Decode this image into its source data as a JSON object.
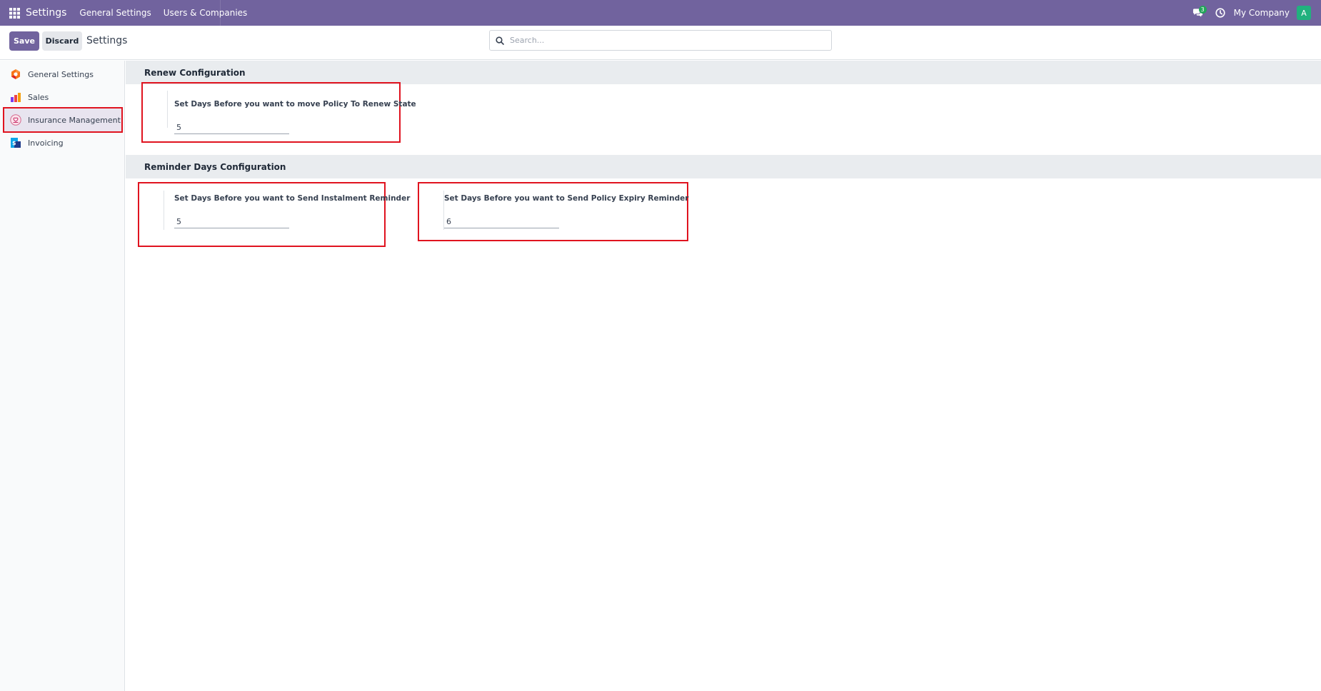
{
  "navbar": {
    "brand": "Settings",
    "menus": [
      "General Settings",
      "Users & Companies"
    ],
    "chat_badge": "3",
    "company": "My Company",
    "avatar_letter": "A",
    "color": "#71639e"
  },
  "control_panel": {
    "save_label": "Save",
    "discard_label": "Discard",
    "title": "Settings",
    "search_placeholder": "Search..."
  },
  "sidebar": {
    "items": [
      {
        "label": "General Settings",
        "icon": "general-settings-icon"
      },
      {
        "label": "Sales",
        "icon": "sales-icon"
      },
      {
        "label": "Insurance Management",
        "icon": "insurance-icon",
        "active": true
      },
      {
        "label": "Invoicing",
        "icon": "invoicing-icon"
      }
    ]
  },
  "sections": {
    "renew": {
      "title": "Renew Configuration",
      "settings": [
        {
          "label": "Set Days Before you want to move Policy To Renew State",
          "value": "5"
        }
      ]
    },
    "reminder": {
      "title": "Reminder Days Configuration",
      "settings": [
        {
          "label": "Set Days Before you want to Send Instalment Reminder",
          "value": "5"
        },
        {
          "label": "Set Days Before you want to Send Policy Expiry Reminder",
          "value": "6"
        }
      ]
    }
  },
  "colors": {
    "highlight": "#e0131f",
    "primary": "#71639e",
    "section_bg": "#e9ecef"
  }
}
